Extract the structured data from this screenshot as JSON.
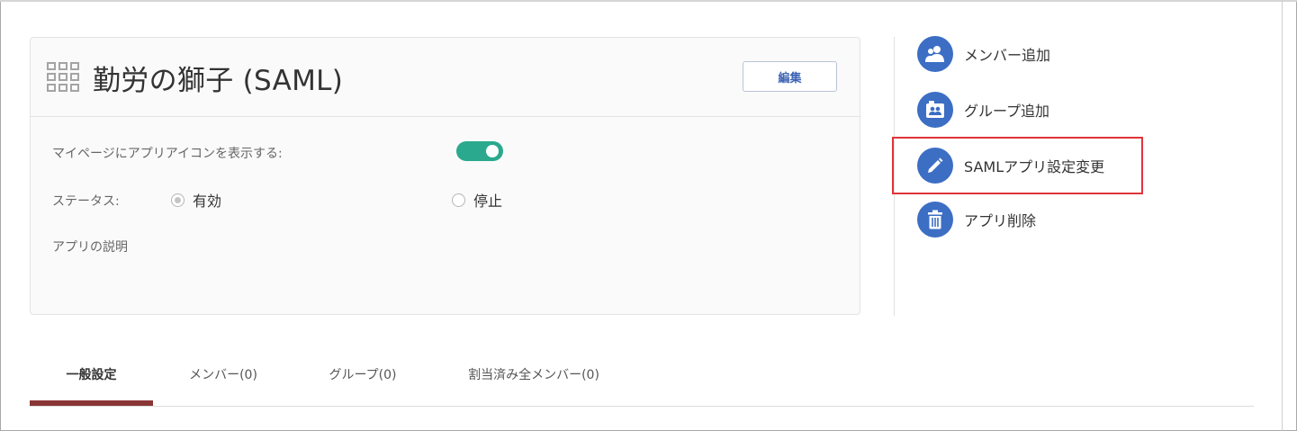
{
  "app": {
    "title": "勤労の獅子 (SAML)",
    "edit_label": "編集",
    "mypage_icon_label": "マイページにアプリアイコンを表示する:",
    "mypage_icon_enabled": true,
    "status_label": "ステータス:",
    "status_options": [
      "有効",
      "停止"
    ],
    "status_selected": "有効",
    "description_label": "アプリの説明"
  },
  "actions": [
    {
      "label": "メンバー追加",
      "icon": "add-member-icon"
    },
    {
      "label": "グループ追加",
      "icon": "add-group-icon"
    },
    {
      "label": "SAMLアプリ設定変更",
      "icon": "pencil-icon",
      "highlighted": true
    },
    {
      "label": "アプリ削除",
      "icon": "trash-icon"
    }
  ],
  "tabs": [
    {
      "label": "一般設定",
      "active": true
    },
    {
      "label": "メンバー(0)"
    },
    {
      "label": "グループ(0)"
    },
    {
      "label": "割当済み全メンバー(0)"
    }
  ],
  "colors": {
    "accent_blue": "#3c6ec4",
    "toggle_green": "#2aa98e",
    "tab_active_underline": "#8a3535",
    "highlight_red": "#e0343a"
  }
}
